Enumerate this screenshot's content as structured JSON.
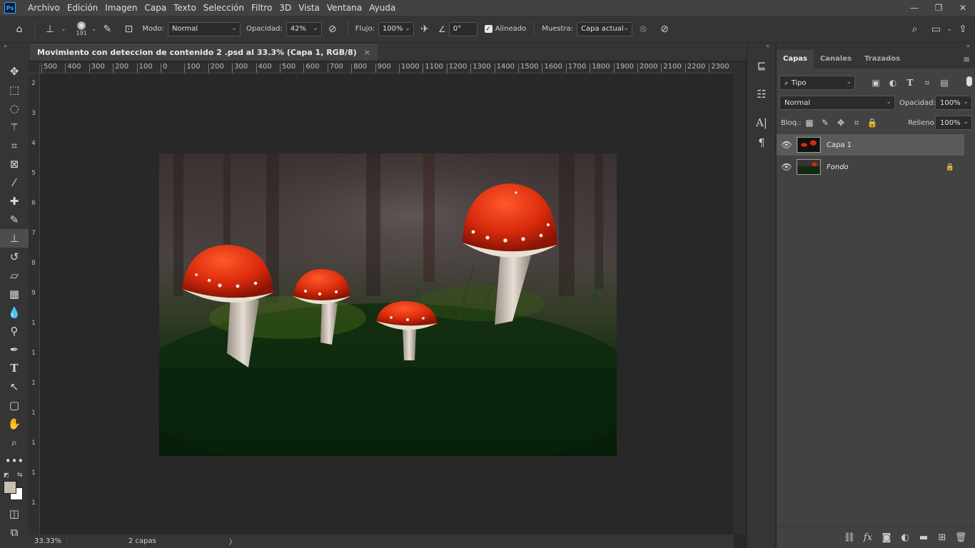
{
  "app": {
    "logo": "Ps"
  },
  "menu": [
    "Archivo",
    "Edición",
    "Imagen",
    "Capa",
    "Texto",
    "Selección",
    "Filtro",
    "3D",
    "Vista",
    "Ventana",
    "Ayuda"
  ],
  "window_controls": {
    "minimize": "—",
    "restore": "❐",
    "close": "✕"
  },
  "options": {
    "brush_size": "191",
    "mode_label": "Modo:",
    "mode_value": "Normal",
    "opacity_label": "Opacidad:",
    "opacity_value": "42%",
    "flow_label": "Flujo:",
    "flow_value": "100%",
    "angle_value": "0°",
    "aligned_label": "Alineado",
    "aligned_checked": true,
    "sample_label": "Muestra:",
    "sample_value": "Capa actual"
  },
  "document": {
    "tab_title": "Movimiento con deteccion de contenido 2 .psd al 33.3% (Capa 1, RGB/8)",
    "tab_close": "×",
    "zoom": "33.33%",
    "status_info": "2 capas",
    "status_arrow": "〉"
  },
  "ruler": {
    "h_labels": [
      "500",
      "400",
      "300",
      "200",
      "100",
      "0",
      "100",
      "200",
      "300",
      "400",
      "500",
      "600",
      "700",
      "800",
      "900",
      "1000",
      "1100",
      "1200",
      "1300",
      "1400",
      "1500",
      "1600",
      "1700",
      "1800",
      "1900",
      "2000",
      "2100",
      "2200",
      "2300"
    ],
    "v_labels": [
      "2",
      "3",
      "4",
      "5",
      "6",
      "7",
      "8",
      "9",
      "1",
      "1",
      "1",
      "1",
      "1",
      "1",
      "1"
    ]
  },
  "panel": {
    "tabs": [
      "Capas",
      "Canales",
      "Trazados"
    ],
    "active_tab": "Capas",
    "filter_label": "Tipo",
    "blend_mode": "Normal",
    "opacity_label": "Opacidad:",
    "opacity_value": "100%",
    "lock_label": "Bloq.:",
    "fill_label": "Relleno:",
    "fill_value": "100%",
    "layers": [
      {
        "name": "Capa 1",
        "visible": true,
        "selected": true,
        "locked": false
      },
      {
        "name": "Fondo",
        "visible": true,
        "selected": false,
        "locked": true
      }
    ]
  },
  "colors": {
    "foreground": "#c9bfb2",
    "background": "#ffffff",
    "accent": "#31a8ff"
  }
}
